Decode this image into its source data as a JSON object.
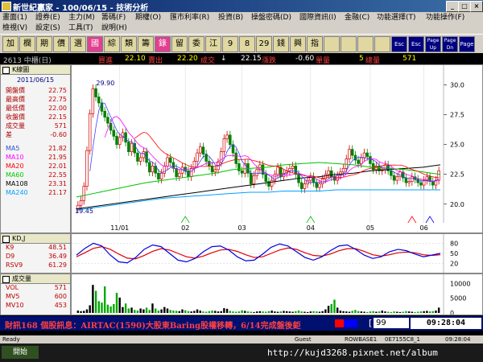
{
  "window": {
    "title": "新世紀贏家 - 100/06/15 - 技術分析",
    "min": "_",
    "max": "□",
    "close": "×"
  },
  "menu_row1": [
    "畫面(1)",
    "證券(E)",
    "主力(M)",
    "籌碼(F)",
    "期權(O)",
    "匯市利率(R)",
    "投資(B)",
    "操盤密碼(D)",
    "國際資訊(I)",
    "金融(C)",
    "功能選擇(T)",
    "功能操作(F)"
  ],
  "menu_row2": [
    "檢視(V)",
    "設定(S)",
    "工具(T)",
    "說明(H)"
  ],
  "toolbar": [
    "加",
    "欄",
    "期",
    "價",
    "選",
    "國",
    "綜",
    "類",
    "籌",
    "錄",
    "留",
    "委",
    "江",
    "9",
    "8",
    "29",
    "錢",
    "興",
    "指"
  ],
  "toolbar_small": [
    "Esc",
    "Esc",
    "Page Up",
    "Page Dn",
    "Page"
  ],
  "info": {
    "code": "2613 中櫃(日)",
    "buy_label": "買進",
    "buy_val": "22.10",
    "sell_label": "賣出",
    "sell_val": "22.20",
    "deal_label": "成交",
    "arrow": "↓",
    "deal_val": "22.15",
    "chg_label": "漲跌",
    "chg_val": "-0.60",
    "unit_label": "單量",
    "unit_val": "5",
    "vol_label": "總量",
    "vol_val": "571"
  },
  "kpanel": {
    "title": "K線圖",
    "date": "2011/06/15",
    "quotes": [
      {
        "label": "開盤價",
        "value": "22.75"
      },
      {
        "label": "最高價",
        "value": "22.75"
      },
      {
        "label": "最低價",
        "value": "22.00"
      },
      {
        "label": "收盤價",
        "value": "22.15"
      },
      {
        "label": "成交量",
        "value": "571"
      },
      {
        "label": "差",
        "value": "-0.60"
      }
    ],
    "ma": [
      {
        "label": "MA5",
        "value": "21.82",
        "color": "#ffffff"
      },
      {
        "label": "MA10",
        "value": "21.95",
        "color": "#ff00ff"
      },
      {
        "label": "MA20",
        "value": "22.01",
        "color": "#ff0000"
      },
      {
        "label": "MA60",
        "value": "22.55",
        "color": "#00cc00"
      },
      {
        "label": "MA108",
        "value": "23.31",
        "color": "#000000"
      },
      {
        "label": "MA240",
        "value": "21.17",
        "color": "#00a0ff"
      }
    ]
  },
  "kdpanel": {
    "title": "KD,J",
    "rows": [
      {
        "label": "K9",
        "value": "48.51"
      },
      {
        "label": "D9",
        "value": "36.49"
      },
      {
        "label": "RSV9",
        "value": "61.29"
      }
    ]
  },
  "volpanel": {
    "title": "成交量",
    "rows": [
      {
        "label": "VOL",
        "value": "571"
      },
      {
        "label": "MV5",
        "value": "600"
      },
      {
        "label": "MV10",
        "value": "453"
      }
    ]
  },
  "annotations": {
    "hi": "29.90",
    "lo": "19.45"
  },
  "chart_data": {
    "type": "candlestick",
    "price_axis": {
      "ticks": [
        "30.0",
        "27.5",
        "25.0",
        "22.5",
        "20.0"
      ],
      "ylim": [
        18.7,
        31.4
      ]
    },
    "x_ticks": [
      "11/01",
      "02",
      "03",
      "04",
      "05",
      "06"
    ],
    "kd_axis": {
      "ticks": [
        "80",
        "50",
        "20"
      ]
    },
    "vol_axis": {
      "ticks": [
        "10000",
        "5000",
        "0"
      ],
      "ylim": [
        0,
        12000
      ]
    },
    "closes": [
      19.9,
      20.3,
      21.5,
      24.5,
      27.6,
      29.7,
      29.0,
      28.5,
      27.8,
      27.3,
      26.8,
      26.2,
      25.7,
      25.0,
      25.6,
      26.0,
      25.2,
      24.4,
      25.1,
      24.3,
      23.6,
      23.9,
      24.4,
      23.5,
      22.7,
      23.2,
      22.6,
      22.1,
      22.6,
      23.2,
      23.9,
      23.5,
      23.0,
      22.3,
      22.6,
      23.1,
      22.8,
      22.3,
      23.0,
      23.6,
      24.3,
      24.8,
      24.2,
      23.6,
      23.2,
      22.7,
      22.9,
      23.5,
      24.4,
      25.5,
      25.8,
      25.0,
      24.3,
      23.4,
      22.8,
      22.6,
      23.4,
      22.6,
      21.7,
      22.4,
      22.9,
      23.3,
      22.5,
      21.9,
      21.5,
      22.0,
      22.5,
      23.1,
      22.3,
      22.6,
      22.8,
      23.0,
      23.2,
      22.5,
      21.8,
      21.3,
      21.7,
      22.0,
      22.3,
      21.8,
      21.4,
      21.7,
      22.1,
      22.5,
      22.8,
      22.3,
      22.0,
      22.4,
      22.7,
      23.0,
      23.8,
      24.6,
      24.1,
      23.7,
      23.4,
      23.9,
      24.3,
      24.0,
      23.4,
      22.9,
      23.2,
      22.8,
      22.9,
      23.3,
      22.8,
      22.4,
      22.0,
      22.3,
      22.7,
      22.2,
      21.8,
      21.9,
      22.3,
      22.1,
      21.8,
      21.6,
      22.0,
      22.3,
      21.9,
      21.6,
      22.0,
      22.8
    ],
    "ma60": [
      20.6,
      20.9,
      21.2,
      21.5,
      21.8,
      22.0,
      22.2,
      22.4,
      22.6,
      22.9,
      23.0,
      23.1,
      23.3,
      23.4,
      23.5,
      23.4,
      23.3,
      23.1,
      23.0,
      22.9,
      22.7,
      22.5
    ],
    "ma108": [
      19.6,
      19.8,
      20.0,
      20.2,
      20.4,
      20.6,
      20.8,
      21.0,
      21.2,
      21.4,
      21.6,
      21.8,
      22.0,
      22.2,
      22.3,
      22.5,
      22.6,
      22.8,
      22.9,
      23.0,
      23.1,
      23.3
    ],
    "ma240": [
      19.5,
      19.7,
      19.9,
      20.1,
      20.3,
      20.5,
      20.6,
      20.7,
      20.8,
      20.9,
      21.0,
      21.0,
      21.1,
      21.1,
      21.1,
      21.2,
      21.2,
      21.2,
      21.2,
      21.2,
      21.2,
      21.2
    ],
    "k": [
      45,
      65,
      80,
      72,
      45,
      25,
      22,
      38,
      62,
      75,
      70,
      50,
      30,
      25,
      35,
      55,
      70,
      72,
      60,
      40,
      28,
      30,
      48,
      68,
      78,
      72,
      55,
      38,
      30,
      40,
      58,
      72,
      75,
      62,
      45,
      35,
      40,
      55,
      62,
      58,
      48,
      40,
      45,
      50
    ],
    "d": [
      40,
      52,
      65,
      70,
      62,
      48,
      36,
      34,
      44,
      56,
      64,
      60,
      50,
      40,
      36,
      42,
      52,
      60,
      62,
      56,
      46,
      38,
      40,
      50,
      60,
      66,
      62,
      52,
      44,
      42,
      48,
      58,
      64,
      64,
      56,
      46,
      42,
      46,
      52,
      54,
      52,
      46,
      44,
      46
    ],
    "volume": [
      800,
      600,
      700,
      1200,
      2600,
      9500,
      7500,
      4000,
      3500,
      9000,
      2800,
      2200,
      3000,
      6800,
      5200,
      2000,
      3200,
      1500,
      1800,
      1000,
      800,
      1500,
      1200,
      1800,
      1000,
      3200,
      1500,
      800,
      1200,
      2000,
      1500,
      1000,
      800,
      700,
      600,
      1200,
      900,
      600,
      500,
      700,
      1200,
      800,
      500,
      400,
      600,
      800,
      700,
      500,
      600,
      1600,
      1400,
      700,
      500,
      400,
      500,
      900,
      700,
      500,
      400,
      300,
      500,
      600,
      500,
      400,
      600,
      800,
      500,
      400,
      500,
      700,
      600,
      500,
      400,
      600,
      800,
      500,
      400,
      300,
      500,
      600,
      500,
      400,
      600,
      1200,
      2400,
      3000,
      4500,
      1800,
      800,
      600,
      500,
      400,
      700,
      1000,
      600,
      500,
      400,
      300,
      500,
      600,
      400,
      500,
      800,
      500,
      400,
      300,
      500,
      400,
      300,
      400,
      600,
      500,
      400,
      300,
      400,
      500,
      600,
      700,
      500,
      600,
      800,
      1800
    ]
  },
  "ticker": {
    "text": "財訊168 個股訊息：AIRTAC(1590)大股東Baring股權移轉，6/14完成盤後鉅",
    "page": "99",
    "clock": "09:28:04"
  },
  "statusbar": {
    "ready": "Ready",
    "guest": "Guest",
    "server": "ROWBASE1",
    "code": "0E7155C8_1",
    "time": "09:28:04"
  },
  "taskbar": {
    "url": "http://kujd3268.pixnet.net/album",
    "start": "開始"
  }
}
